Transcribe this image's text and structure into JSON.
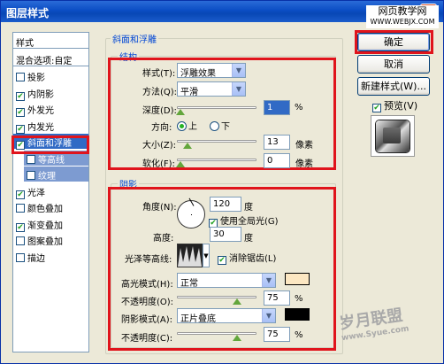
{
  "window": {
    "title": "图层样式",
    "close": "✕"
  },
  "watermark_top": {
    "line1": "网页教学网",
    "line2": "WWW.WEBJX.COM"
  },
  "watermark_bottom": {
    "line1": "岁月联盟",
    "line2": "www.Syue.com"
  },
  "styles_panel": {
    "header": "样式",
    "blend": "混合选项:自定",
    "items": [
      {
        "label": "投影",
        "checked": false
      },
      {
        "label": "内阴影",
        "checked": true
      },
      {
        "label": "外发光",
        "checked": true
      },
      {
        "label": "内发光",
        "checked": true
      },
      {
        "label": "斜面和浮雕",
        "checked": true,
        "selected": true
      },
      {
        "label": "等高线",
        "checked": false,
        "sub": true
      },
      {
        "label": "纹理",
        "checked": false,
        "sub": true
      },
      {
        "label": "光泽",
        "checked": true
      },
      {
        "label": "颜色叠加",
        "checked": false
      },
      {
        "label": "渐变叠加",
        "checked": true
      },
      {
        "label": "图案叠加",
        "checked": false
      },
      {
        "label": "描边",
        "checked": false
      }
    ]
  },
  "bevel": {
    "group_title": "斜面和浮雕",
    "structure": {
      "title": "结构",
      "style_label": "样式(T):",
      "style_value": "浮雕效果",
      "technique_label": "方法(Q):",
      "technique_value": "平滑",
      "depth_label": "深度(D):",
      "depth_value": "1",
      "depth_unit": "%",
      "direction_label": "方向:",
      "dir_up": "上",
      "dir_down": "下",
      "size_label": "大小(Z):",
      "size_value": "13",
      "size_unit": "像素",
      "soften_label": "软化(F):",
      "soften_value": "0",
      "soften_unit": "像素"
    },
    "shading": {
      "title": "阴影",
      "angle_label": "角度(N):",
      "angle_value": "120",
      "angle_unit": "度",
      "global_light": "使用全局光(G)",
      "altitude_label": "高度:",
      "altitude_value": "30",
      "altitude_unit": "度",
      "gloss_label": "光泽等高线:",
      "anti_alias": "消除锯齿(L)",
      "highlight_mode_label": "高光模式(H):",
      "highlight_mode": "正常",
      "highlight_color": "#fce7c2",
      "opacity1_label": "不透明度(O):",
      "opacity1_value": "75",
      "opacity1_unit": "%",
      "shadow_mode_label": "阴影模式(A):",
      "shadow_mode": "正片叠底",
      "shadow_color": "#000000",
      "opacity2_label": "不透明度(C):",
      "opacity2_value": "75",
      "opacity2_unit": "%"
    }
  },
  "buttons": {
    "ok": "确定",
    "cancel": "取消",
    "new_style": "新建样式(W)...",
    "preview": "预览(V)"
  }
}
